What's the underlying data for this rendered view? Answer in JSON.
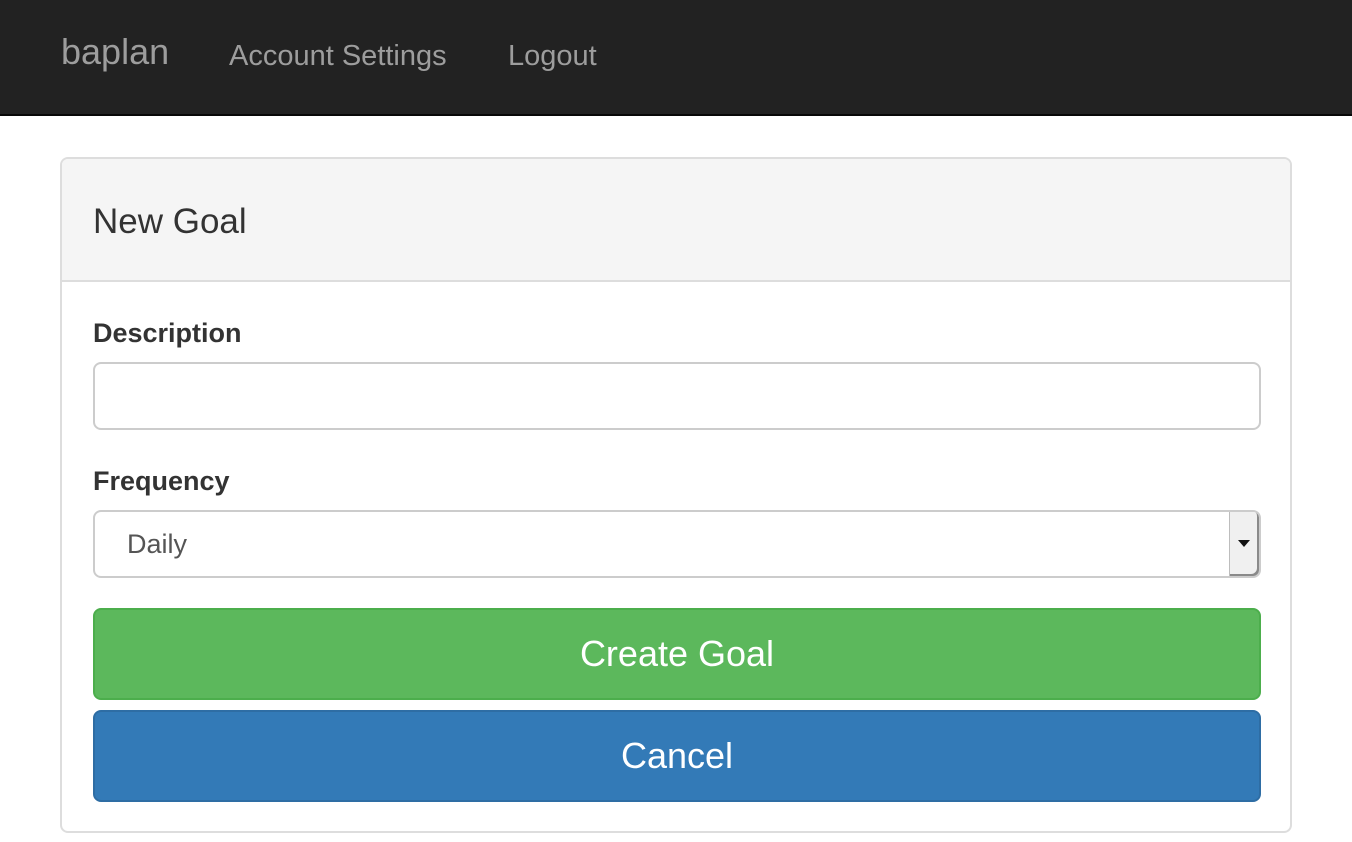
{
  "navbar": {
    "brand": "baplan",
    "links": [
      {
        "label": "Account Settings"
      },
      {
        "label": "Logout"
      }
    ],
    "background": "#222222",
    "link_color": "#9d9d9d"
  },
  "panel": {
    "title": "New Goal",
    "heading_background": "#f5f5f5"
  },
  "form": {
    "description": {
      "label": "Description",
      "value": "",
      "placeholder": ""
    },
    "frequency": {
      "label": "Frequency",
      "selected": "Daily",
      "icon": "chevron-down-icon"
    },
    "buttons": {
      "create_label": "Create Goal",
      "create_color": "#5cb85c",
      "cancel_label": "Cancel",
      "cancel_color": "#337ab7"
    }
  }
}
